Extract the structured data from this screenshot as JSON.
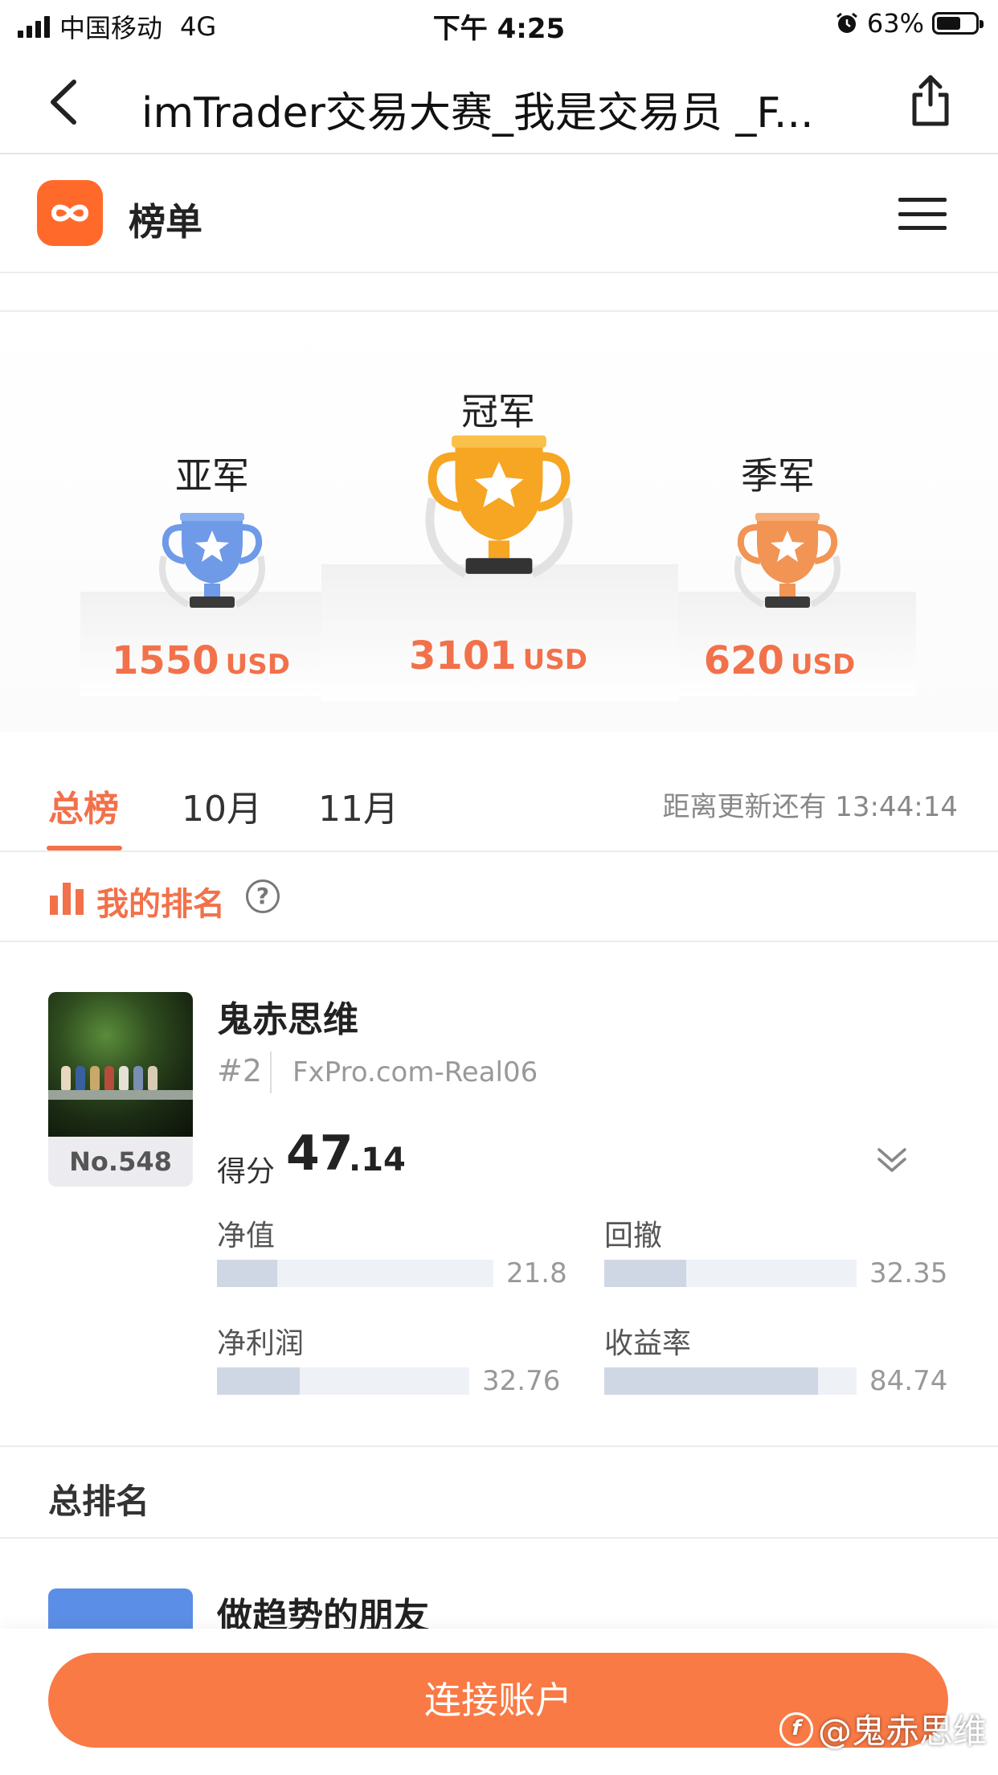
{
  "status_bar": {
    "carrier": "中国移动",
    "network": "4G",
    "time": "下午 4:25",
    "battery": "63%",
    "battery_level": 0.63
  },
  "nav": {
    "title": "imTrader交易大赛_我是交易员 _F..."
  },
  "header": {
    "title": "榜单"
  },
  "podium": {
    "first": {
      "label": "冠军",
      "amount": "3101",
      "unit": "USD"
    },
    "second": {
      "label": "亚军",
      "amount": "1550",
      "unit": "USD"
    },
    "third": {
      "label": "季军",
      "amount": "620",
      "unit": "USD"
    }
  },
  "tabs": {
    "items": [
      {
        "label": "总榜",
        "active": true
      },
      {
        "label": "10月",
        "active": false
      },
      {
        "label": "11月",
        "active": false
      }
    ],
    "countdown": "距离更新还有 13:44:14"
  },
  "my_rank": {
    "label": "我的排名",
    "help": "?"
  },
  "entry": {
    "name": "鬼赤思维",
    "position": "#2",
    "server": "FxPro.com-Real06",
    "rank": "No.548",
    "score_label": "得分",
    "score_int": "47",
    "score_dec": ".14",
    "metrics": [
      {
        "label": "净值",
        "value": "21.8",
        "fraction": 0.218
      },
      {
        "label": "回撤",
        "value": "32.35",
        "fraction": 0.3235
      },
      {
        "label": "净利润",
        "value": "32.76",
        "fraction": 0.3276
      },
      {
        "label": "收益率",
        "value": "84.74",
        "fraction": 0.8474
      }
    ]
  },
  "overall": {
    "title": "总排名",
    "next_name": "做趋势的朋友"
  },
  "bottom": {
    "connect_label": "连接账户"
  },
  "watermark": {
    "text": "@鬼赤思维"
  },
  "colors": {
    "accent": "#f2714a",
    "button": "#f97a45",
    "bar_fill": "#cfd7e4",
    "bar_track": "#eef1f6"
  }
}
